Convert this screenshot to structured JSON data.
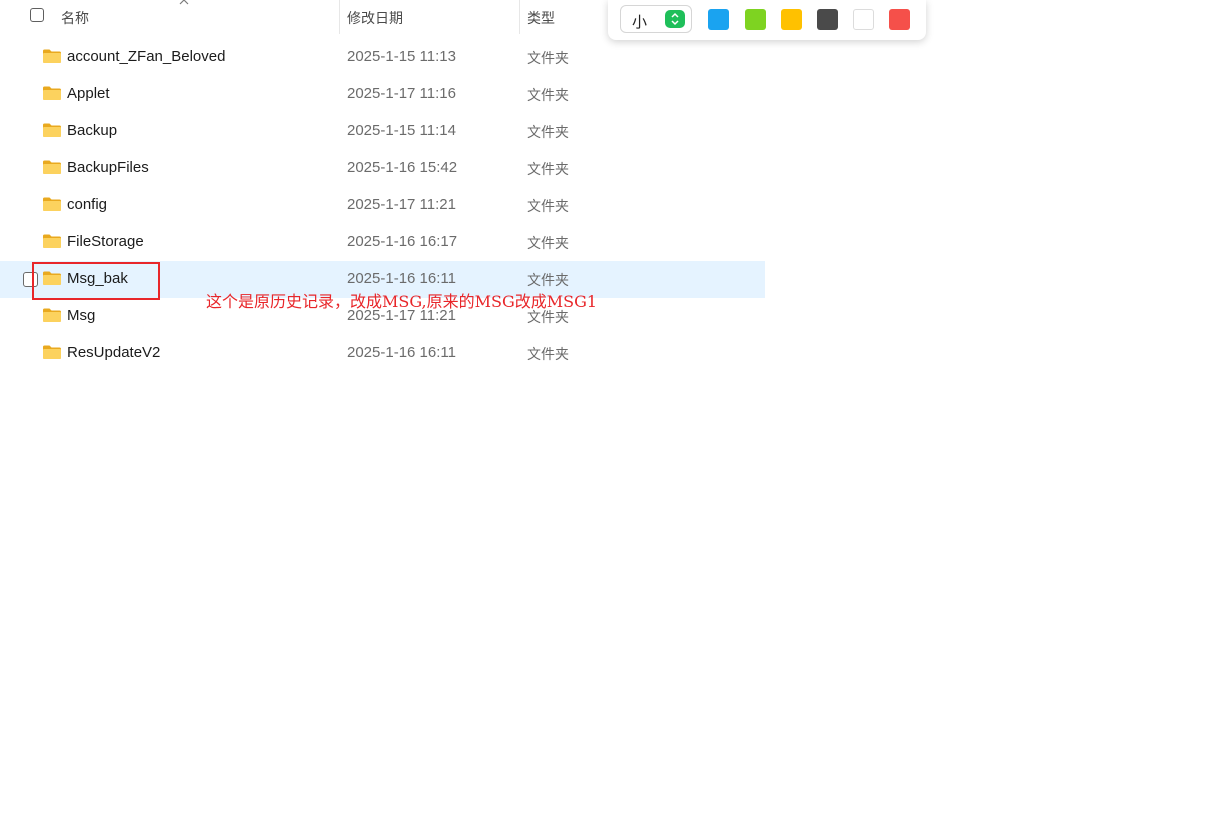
{
  "header": {
    "columns": [
      "名称",
      "修改日期",
      "类型"
    ]
  },
  "rows": [
    {
      "name": "account_ZFan_Beloved",
      "date": "2025-1-15 11:13",
      "type": "文件夹"
    },
    {
      "name": "Applet",
      "date": "2025-1-17 11:16",
      "type": "文件夹"
    },
    {
      "name": "Backup",
      "date": "2025-1-15 11:14",
      "type": "文件夹"
    },
    {
      "name": "BackupFiles",
      "date": "2025-1-16 15:42",
      "type": "文件夹"
    },
    {
      "name": "config",
      "date": "2025-1-17 11:21",
      "type": "文件夹"
    },
    {
      "name": "FileStorage",
      "date": "2025-1-16 16:17",
      "type": "文件夹"
    },
    {
      "name": "Msg_bak",
      "date": "2025-1-16 16:11",
      "type": "文件夹",
      "selected": true
    },
    {
      "name": "Msg",
      "date": "2025-1-17 11:21",
      "type": "文件夹"
    },
    {
      "name": "ResUpdateV2",
      "date": "2025-1-16 16:11",
      "type": "文件夹"
    }
  ],
  "annotation": {
    "text": "这个是原历史记录，改成MSG,原来的MSG改成MSG1",
    "color": "#e8262a"
  },
  "toolbar": {
    "size_label": "小",
    "colors": [
      "#1aa3f0",
      "#7ed321",
      "#ffc100",
      "#4a4a4a",
      "#ffffff",
      "#f5504a"
    ]
  },
  "icons": {
    "folder": "folder-icon",
    "sort": "sort-up-icon",
    "size_toggle": "updown-icon"
  },
  "colors": {
    "selection": "#e5f3ff",
    "folder": "#f8c94c"
  }
}
